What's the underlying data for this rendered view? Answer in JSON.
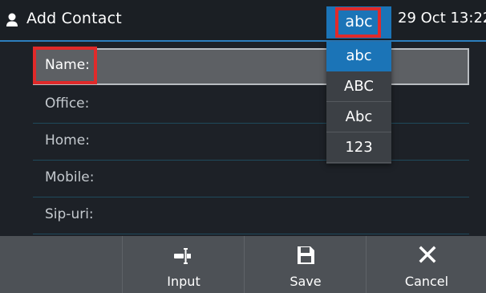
{
  "header": {
    "title": "Add Contact",
    "input_mode": "abc",
    "datetime": "29 Oct 13:22",
    "icon": "contact-person-icon"
  },
  "form": {
    "fields": [
      {
        "label": "Name:",
        "value": "",
        "active": true
      },
      {
        "label": "Office:",
        "value": ""
      },
      {
        "label": "Home:",
        "value": ""
      },
      {
        "label": "Mobile:",
        "value": ""
      },
      {
        "label": "Sip-uri:",
        "value": ""
      }
    ]
  },
  "input_mode_menu": {
    "options": [
      "abc",
      "ABC",
      "Abc",
      "123"
    ],
    "selected": "abc"
  },
  "softkeys": {
    "items": [
      {
        "label": "",
        "icon": ""
      },
      {
        "label": "Input",
        "icon": "input-cursor-icon"
      },
      {
        "label": "Save",
        "icon": "save-disk-icon"
      },
      {
        "label": "Cancel",
        "icon": "close-icon"
      }
    ]
  },
  "colors": {
    "accent": "#1b74b7",
    "highlight": "#e02a2a",
    "background": "#1d2127",
    "softkey_bar": "#4d5156"
  }
}
